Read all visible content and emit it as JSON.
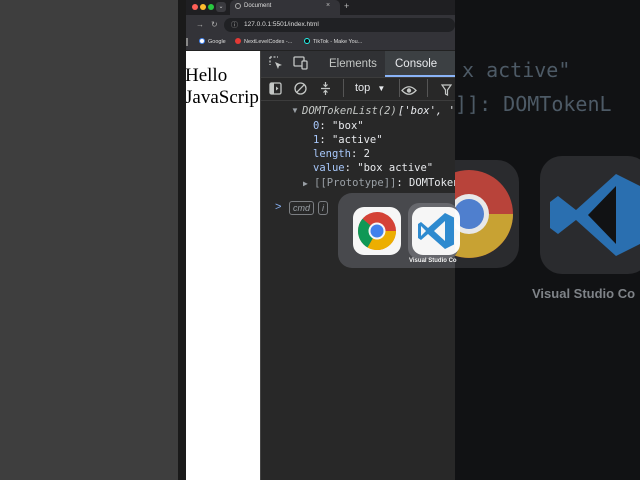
{
  "browser": {
    "tab_title": "Document",
    "tab_close": "×",
    "new_tab": "+",
    "url": "127.0.0.1:5501/index.html",
    "bookmarks": [
      {
        "label": "Google"
      },
      {
        "label": "NextLevelCodes -..."
      },
      {
        "label": "TikTok - Make You..."
      }
    ]
  },
  "page": {
    "line1": "Hello",
    "line2": "JavaScrip"
  },
  "devtools": {
    "tabs": [
      "Elements",
      "Console"
    ],
    "context": "top",
    "console": {
      "header_name": "DOMTokenList(2)",
      "header_preview": "['box', 'a",
      "entries": [
        {
          "key": "0",
          "value": "\"box\""
        },
        {
          "key": "1",
          "value": "\"active\""
        },
        {
          "key": "length",
          "value": "2"
        },
        {
          "key": "value",
          "value": "\"box active\""
        }
      ],
      "proto_key": "[[Prototype]]",
      "proto_value": "DOMTokenL",
      "prompt": ">",
      "chips": [
        "cmd",
        "i"
      ]
    }
  },
  "switcher": {
    "apps": [
      "Chrome",
      "Visual Studio Code"
    ],
    "selected_label": "Visual Studio Co"
  },
  "background": {
    "code_line1": "x active\"",
    "code_line2": "]]: DOMTokenL",
    "app_label": "Visual Studio Co"
  },
  "colors": {
    "accent": "#8ab4f8",
    "devtools_bg": "#282828",
    "vscode_blue": "#2f8fd6",
    "chrome_red": "#db4437",
    "chrome_yellow": "#f4b400",
    "chrome_green": "#0f9d58",
    "chrome_blue": "#4285f4"
  }
}
